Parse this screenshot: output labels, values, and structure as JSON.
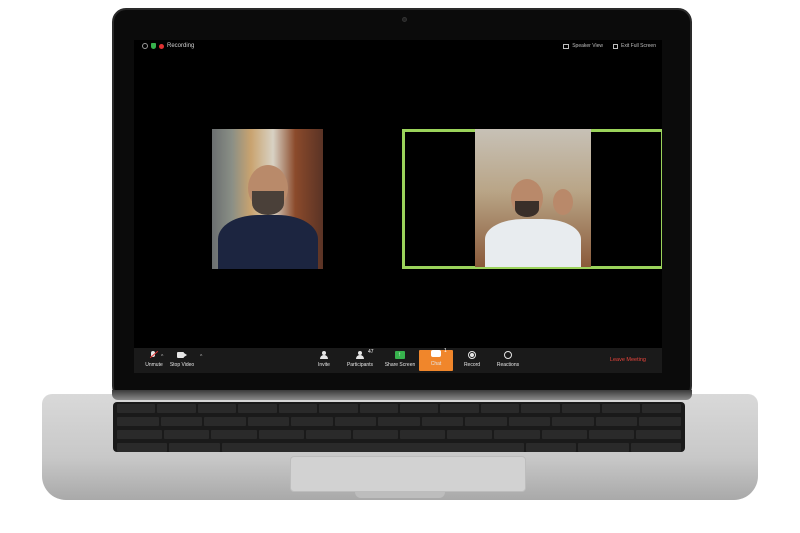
{
  "topbar": {
    "recording_label": "Recording",
    "speaker_view_label": "Speaker View",
    "exit_fullscreen_label": "Exit Full Screen"
  },
  "participants_video": [
    {
      "role": "speaker-left"
    },
    {
      "role": "active-speaker"
    }
  ],
  "toolbar": {
    "unmute_label": "Unmute",
    "stop_video_label": "Stop Video",
    "invite_label": "Invite",
    "participants_label": "Participants",
    "participants_count": "47",
    "share_screen_label": "Share Screen",
    "chat_label": "Chat",
    "chat_count": "1",
    "record_label": "Record",
    "reactions_label": "Reactions",
    "leave_label": "Leave Meeting"
  },
  "colors": {
    "active_speaker_border": "#9bd35b",
    "chat_highlight": "#f0862b",
    "leave_text": "#e8453c",
    "recording_dot": "#e03131",
    "share_screen": "#37b24d"
  },
  "icons": [
    "info-icon",
    "shield-icon",
    "recording-icon",
    "grid-icon",
    "exit-fullscreen-icon",
    "microphone-muted-icon",
    "video-camera-icon",
    "invite-icon",
    "participants-icon",
    "share-screen-icon",
    "chat-icon",
    "record-icon",
    "reactions-icon",
    "chevron-up-icon"
  ]
}
